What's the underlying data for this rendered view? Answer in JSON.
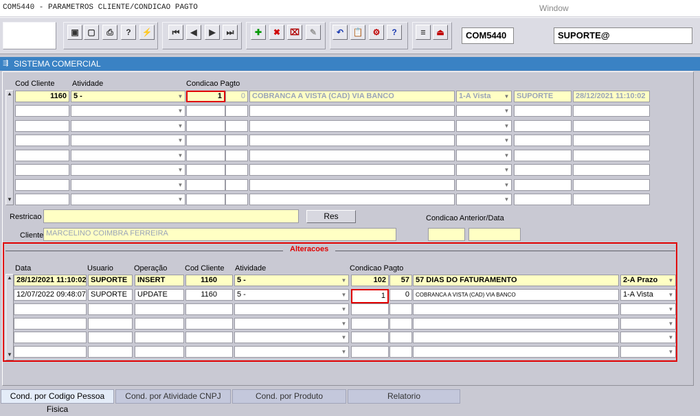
{
  "window": {
    "title": "COM5440 - PARAMETROS CLIENTE/CONDICAO PAGTO",
    "menu": "Window"
  },
  "toolbar": {
    "form_code": "COM5440",
    "user": "SUPORTE@"
  },
  "section": {
    "title": "SISTEMA COMERCIAL"
  },
  "master": {
    "headers": {
      "cod_cliente": "Cod Cliente",
      "atividade": "Atividade",
      "condicao_pagto": "Condicao Pagto"
    },
    "row1": {
      "cod_cliente": "1160",
      "atividade": "5 -",
      "cond_code": "1",
      "cond_num": "0",
      "cond_desc": "COBRANCA A VISTA (CAD) VIA BANCO",
      "tipo": "1-A Vista",
      "usuario": "SUPORTE",
      "data": "28/12/2021 11:10:02"
    }
  },
  "restricao": {
    "label": "Restricao",
    "value": "",
    "button": "Res"
  },
  "cliente": {
    "label": "Cliente",
    "value": "MARCELINO COIMBRA FERREIRA"
  },
  "anterior": {
    "label": "Condicao Anterior/Data",
    "cond": "",
    "data": ""
  },
  "alteracoes": {
    "title": "Alteracoes",
    "headers": {
      "data": "Data",
      "usuario": "Usuario",
      "operacao": "Operação",
      "cod_cliente": "Cod Cliente",
      "atividade": "Atividade",
      "condicao_pagto": "Condicao Pagto"
    },
    "rows": [
      {
        "data": "28/12/2021 11:10:02",
        "usuario": "SUPORTE",
        "operacao": "INSERT",
        "cod_cliente": "1160",
        "atividade": "5 -",
        "cond_code": "102",
        "cond_num": "57",
        "cond_desc": "57 DIAS DO FATURAMENTO",
        "tipo": "2-A Prazo"
      },
      {
        "data": "12/07/2022 09:48:07",
        "usuario": "SUPORTE",
        "operacao": "UPDATE",
        "cod_cliente": "1160",
        "atividade": "5 -",
        "cond_code": "1",
        "cond_num": "0",
        "cond_desc": "COBRANCA A VISTA (CAD) VIA BANCO",
        "tipo": "1-A Vista"
      }
    ]
  },
  "tabs": [
    {
      "label": "Cond. por Codigo Pessoa Fisica"
    },
    {
      "label": "Cond. por Atividade CNPJ"
    },
    {
      "label": "Cond. por Produto"
    },
    {
      "label": "Relatorio"
    }
  ]
}
